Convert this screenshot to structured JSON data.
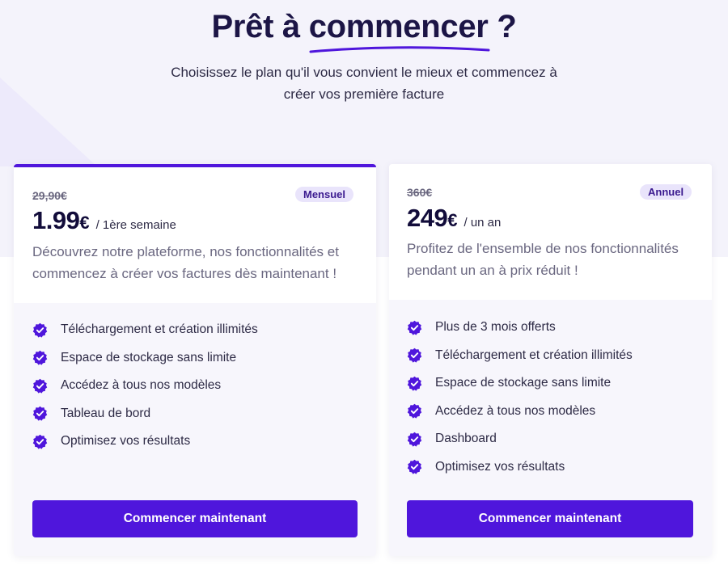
{
  "header": {
    "title_prefix": "Prêt à ",
    "title_highlight": "commencer",
    "title_suffix": " ?",
    "subtitle": "Choisissez le plan qu'il vous convient le mieux et commencez à créer vos première facture"
  },
  "colors": {
    "accent": "#4f16dc",
    "badge_bg": "#e9e4fb",
    "title": "#1c1546",
    "card_bg": "#f7f6fc"
  },
  "plans": [
    {
      "old_price": "29,90€",
      "badge": "Mensuel",
      "price": "1.99",
      "currency": "€",
      "period": "/ 1ère semaine",
      "description": "Découvrez notre plateforme, nos fonctionnalités et commencez à créer vos factures dès maintenant !",
      "features": [
        "Téléchargement et création illimités",
        "Espace de stockage sans limite",
        "Accédez à tous nos modèles",
        "Tableau de bord",
        "Optimisez vos résultats"
      ],
      "feature_icon": "verified-check-icon",
      "cta": "Commencer maintenant"
    },
    {
      "old_price": "360€",
      "badge": "Annuel",
      "price": "249",
      "currency": "€",
      "period": "/ un an",
      "description": "Profitez de l'ensemble de nos fonctionnalités pendant un an à prix réduit !",
      "features": [
        "Plus de 3 mois offerts",
        "Téléchargement et création illimités",
        "Espace de stockage sans limite",
        "Accédez à tous nos modèles",
        "Dashboard",
        "Optimisez vos résultats"
      ],
      "feature_icon": "verified-check-icon",
      "cta": "Commencer maintenant"
    }
  ]
}
